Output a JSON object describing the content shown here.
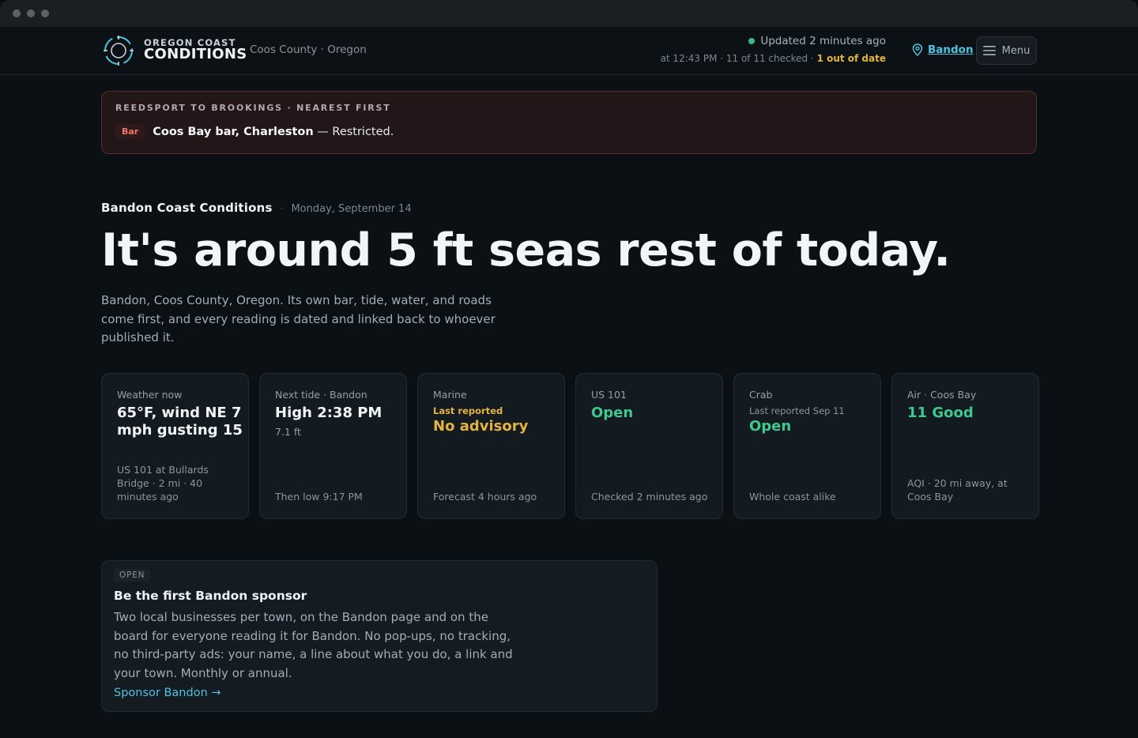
{
  "header": {
    "brand_top": "OREGON COAST",
    "brand_main": "CONDITIONS",
    "region": "Coos County · Oregon",
    "updated": "Updated 2 minutes ago",
    "status_time": "at 12:43 PM · 11 of 11 checked · ",
    "status_warn": "1 out of date",
    "location": "Bandon",
    "menu_label": "Menu"
  },
  "alert": {
    "kicker": "REEDSPORT TO BROOKINGS · NEAREST FIRST",
    "tag": "Bar",
    "place": "Coos Bay bar, Charleston",
    "status": " — Restricted."
  },
  "page": {
    "name": "Bandon Coast Conditions",
    "sep": "·",
    "date": "Monday, September 14",
    "headline": "It's around 5 ft seas rest of today.",
    "intro": "Bandon, Coos County, Oregon. Its own bar, tide, water, and roads come first, and every reading is dated and linked back to whoever published it."
  },
  "cards": {
    "weather": {
      "label": "Weather now",
      "value": "65°F, wind NE 7 mph gusting 15",
      "foot": "US 101 at Bullards Bridge · 2 mi · 40 minutes ago"
    },
    "tide": {
      "label": "Next tide · Bandon",
      "value": "High 2:38 PM",
      "small": "7.1 ft",
      "foot": "Then low 9:17 PM"
    },
    "marine": {
      "label": "Marine",
      "sub": "Last reported",
      "value": "No advisory",
      "foot": "Forecast 4 hours ago"
    },
    "road": {
      "label": "US 101",
      "value": "Open",
      "foot": "Checked 2 minutes ago"
    },
    "crab": {
      "label": "Crab",
      "sub": "Last reported Sep 11",
      "value": "Open",
      "foot": "Whole coast alike"
    },
    "air": {
      "label": "Air · Coos Bay",
      "value": "11 Good",
      "foot": "AQI · 20 mi away, at Coos Bay"
    }
  },
  "sponsor": {
    "badge": "OPEN",
    "title": "Be the first Bandon sponsor",
    "body": "Two local businesses per town, on the Bandon page and on the board for everyone reading it for Bandon. No pop-ups, no tracking, no third-party ads: your name, a line about what you do, a link and your town. Monthly or annual.",
    "link": "Sponsor Bandon →"
  },
  "colors": {
    "accent": "#4fc3e0",
    "good": "#3fc98f",
    "warn": "#e3b341",
    "alert": "#f0756b"
  },
  "icons": [
    "compass-logo-icon",
    "location-pin-icon",
    "hamburger-menu-icon"
  ]
}
